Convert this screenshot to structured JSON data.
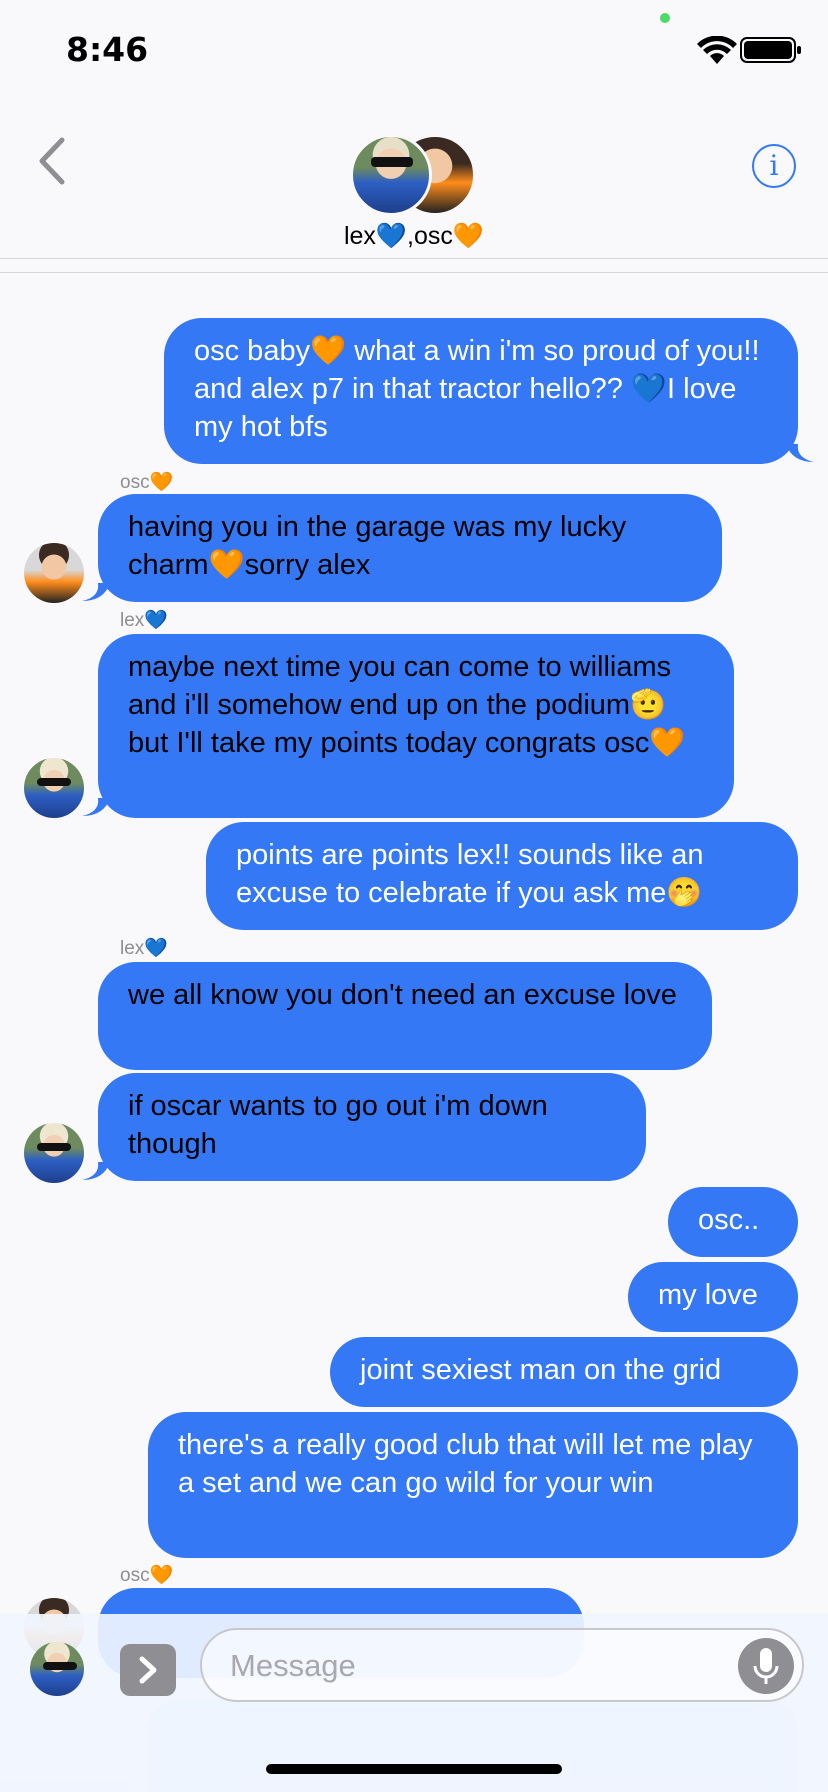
{
  "status_bar": {
    "time": "8:46"
  },
  "header": {
    "group_name": "lex💙,osc🧡"
  },
  "messages": {
    "m1": "osc baby🧡 what a win i'm so proud of you!! and alex p7 in that tractor hello?? 💙I love my hot bfs",
    "s1": "osc🧡",
    "m2": "having you in the garage was my lucky charm🧡sorry alex",
    "s2": "lex💙",
    "m3": "maybe next time you can come to williams and i'll somehow end up on the podium🫡 but I'll take my points today congrats osc🧡",
    "m4": "points are points lex!! sounds like an excuse to celebrate if you ask me🤭",
    "s3": "lex💙",
    "m5": "we all know you don't need an excuse love",
    "m6": "if oscar wants to go out i'm down though",
    "m7": "osc..",
    "m8": "my love",
    "m9": "joint sexiest man on the grid",
    "m10": "there's a really good club that will let me play a set and we can go wild for your win",
    "s4": "osc🧡"
  },
  "input": {
    "placeholder": "Message"
  },
  "colors": {
    "bubble": "#3478f6",
    "accent": "#3478f6"
  }
}
